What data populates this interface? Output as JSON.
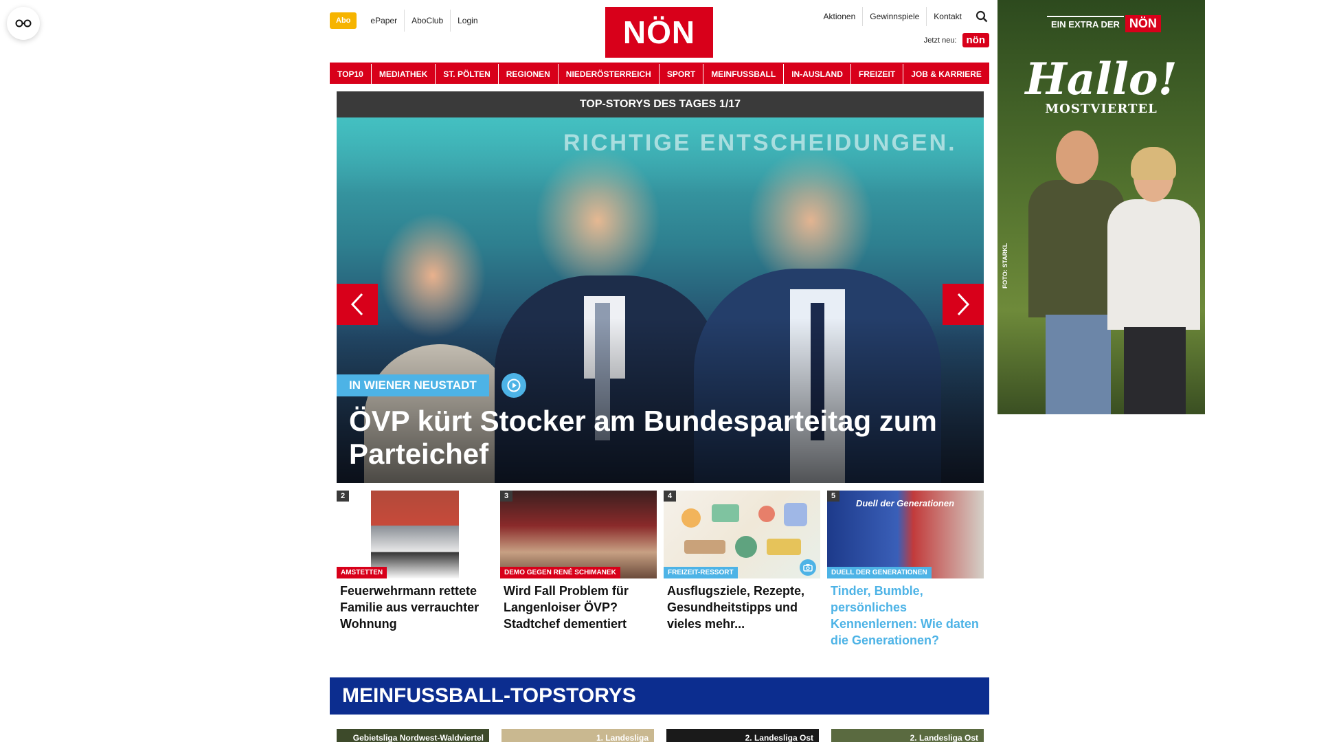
{
  "header": {
    "abo_label": "Abo",
    "left_links": [
      "ePaper",
      "AboClub",
      "Login"
    ],
    "logo_text": "NÖN",
    "right_links": [
      "Aktionen",
      "Gewinnspiele",
      "Kontakt"
    ],
    "jetzt_label": "Jetzt neu:",
    "jetzt_logo": "nön"
  },
  "nav": {
    "items": [
      "TOP10",
      "MEDIATHEK",
      "ST. PÖLTEN",
      "REGIONEN",
      "NIEDERÖSTERREICH",
      "SPORT",
      "MEINFUSSBALL",
      "IN-AUSLAND",
      "FREIZEIT",
      "JOB & KARRIERE"
    ]
  },
  "hero": {
    "header": "TOP-STORYS DES TAGES 1/17",
    "banner_text": "RICHTIGE ENTSCHEIDUNGEN.",
    "tag": "IN WIENER NEUSTADT",
    "title": "ÖVP kürt Stocker am Bundesparteitag zum Parteichef"
  },
  "cards": [
    {
      "num": "2",
      "tag": "AMSTETTEN",
      "title": "Feuerwehrmann rettete Familie aus verrauchter Wohnung"
    },
    {
      "num": "3",
      "tag": "DEMO GEGEN RENÉ SCHIMANEK",
      "title": "Wird Fall Problem für Langenloiser ÖVP? Stadtchef dementiert"
    },
    {
      "num": "4",
      "tag": "FREIZEIT-RESSORT",
      "title": "Ausflugsziele, Rezepte, Gesundheitstipps und vieles mehr..."
    },
    {
      "num": "5",
      "tag": "DUELL DER GENERATIONEN",
      "title": "Tinder, Bumble, persönliches Kennenlernen: Wie daten die Generationen?",
      "image_text": "Duell der Generationen"
    }
  ],
  "section": {
    "title": "MEINFUSSBALL-TOPSTORYS",
    "mini_cards": [
      "Gebietsliga Nordwest-Waldviertel",
      "1. Landesliga",
      "2. Landesliga Ost",
      "2. Landesliga Ost"
    ]
  },
  "ad": {
    "extra_label": "EIN EXTRA DER",
    "logo_text": "NÖN",
    "headline": "Hallo!",
    "subline": "MOSTVIERTEL",
    "photo_credit": "FOTO: STARKL"
  },
  "colors": {
    "brand_red": "#d8001a",
    "accent_blue": "#4db3e6",
    "section_blue": "#0c2d8f",
    "abo_yellow": "#f6b400"
  }
}
